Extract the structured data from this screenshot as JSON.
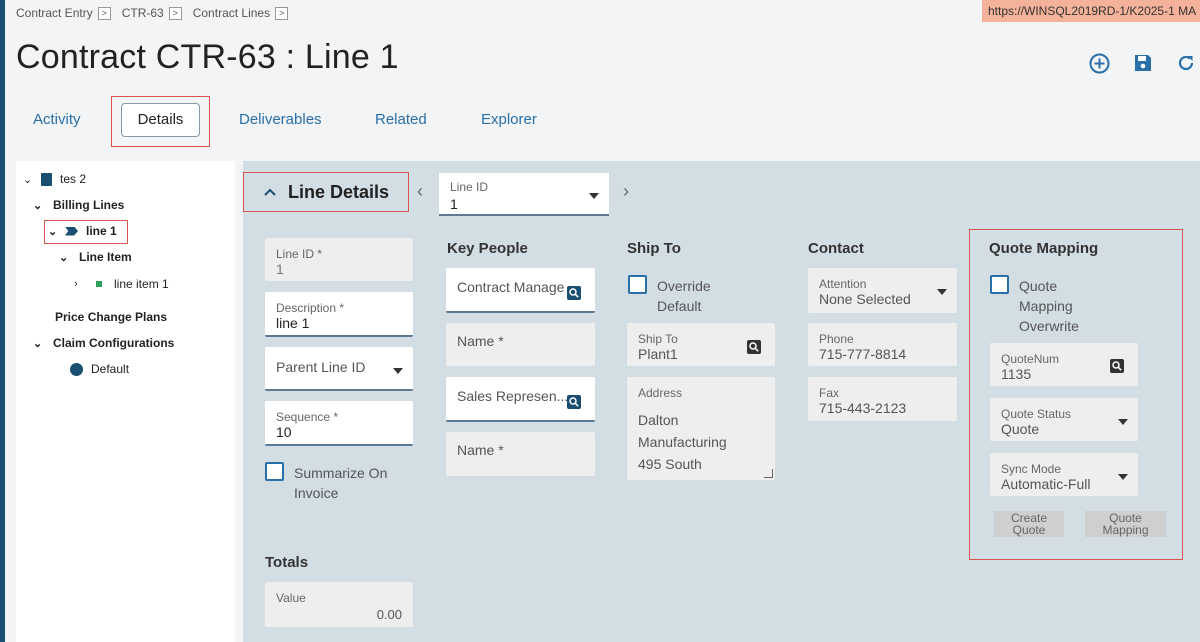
{
  "breadcrumb": [
    {
      "label": "Contract Entry"
    },
    {
      "label": "CTR-63"
    },
    {
      "label": "Contract Lines"
    }
  ],
  "url_badge": "https://WINSQL2019RD-1/K2025-1 MA",
  "page_title": "Contract CTR-63 : Line 1",
  "tabs": {
    "activity": "Activity",
    "details": "Details",
    "deliverables": "Deliverables",
    "related": "Related",
    "explorer": "Explorer"
  },
  "tree": {
    "root": "tes 2",
    "billing_lines": "Billing Lines",
    "line1": "line 1",
    "line_item": "Line Item",
    "line_item1": "line item 1",
    "price_change_plans": "Price Change Plans",
    "claim_configurations": "Claim Configurations",
    "default": "Default"
  },
  "section": {
    "title": "Line Details",
    "selector_label": "Line ID",
    "selector_value": "1"
  },
  "line": {
    "line_id_label": "Line ID *",
    "line_id_value": "1",
    "description_label": "Description *",
    "description_value": "line 1",
    "parent_line_label": "Parent Line ID",
    "sequence_label": "Sequence *",
    "sequence_value": "10",
    "summarize_label_1": "Summarize On",
    "summarize_label_2": "Invoice"
  },
  "key_people": {
    "header": "Key People",
    "contract_manager": "Contract Manage",
    "name1": "Name *",
    "sales_rep": "Sales Represen...",
    "name2": "Name *"
  },
  "ship_to": {
    "header": "Ship To",
    "override_1": "Override",
    "override_2": "Default",
    "ship_to_label": "Ship To",
    "ship_to_value": "Plant1",
    "address_label": "Address",
    "address_line1": "Dalton",
    "address_line2": "Manufacturing",
    "address_line3": "495 South"
  },
  "contact": {
    "header": "Contact",
    "attention_label": "Attention",
    "attention_value": "None Selected",
    "phone_label": "Phone",
    "phone_value": "715-777-8814",
    "fax_label": "Fax",
    "fax_value": "715-443-2123"
  },
  "quote_mapping": {
    "header": "Quote Mapping",
    "overwrite_1": "Quote",
    "overwrite_2": "Mapping",
    "overwrite_3": "Overwrite",
    "quotenum_label": "QuoteNum",
    "quotenum_value": "1135",
    "status_label": "Quote Status",
    "status_value": "Quote",
    "sync_label": "Sync Mode",
    "sync_value": "Automatic-Full",
    "create_btn_1": "Create",
    "create_btn_2": "Quote",
    "mapping_btn_1": "Quote",
    "mapping_btn_2": "Mapping"
  },
  "totals": {
    "header": "Totals",
    "value_label": "Value",
    "value": "0.00"
  },
  "colors": {
    "accent": "#2a6fa8",
    "highlight": "#d9534f",
    "url_badge": "#f4b29a",
    "panel": "#d3dde4"
  }
}
